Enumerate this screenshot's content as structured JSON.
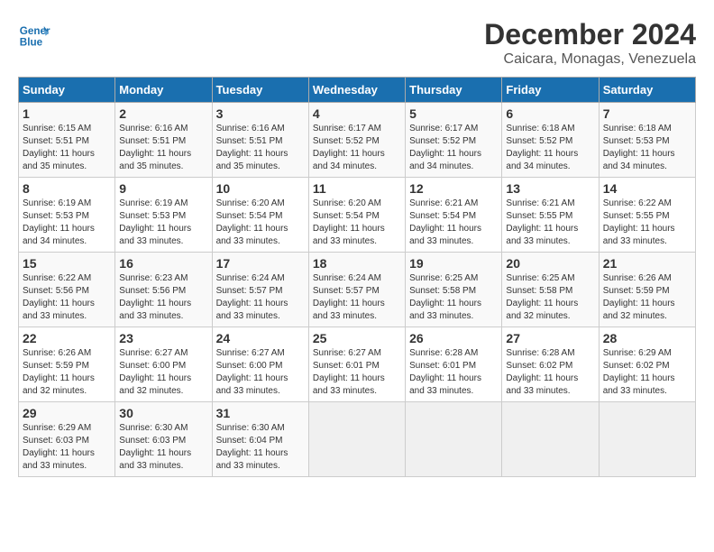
{
  "logo": {
    "line1": "General",
    "line2": "Blue"
  },
  "title": "December 2024",
  "location": "Caicara, Monagas, Venezuela",
  "weekdays": [
    "Sunday",
    "Monday",
    "Tuesday",
    "Wednesday",
    "Thursday",
    "Friday",
    "Saturday"
  ],
  "weeks": [
    [
      {
        "day": "1",
        "info": "Sunrise: 6:15 AM\nSunset: 5:51 PM\nDaylight: 11 hours\nand 35 minutes."
      },
      {
        "day": "2",
        "info": "Sunrise: 6:16 AM\nSunset: 5:51 PM\nDaylight: 11 hours\nand 35 minutes."
      },
      {
        "day": "3",
        "info": "Sunrise: 6:16 AM\nSunset: 5:51 PM\nDaylight: 11 hours\nand 35 minutes."
      },
      {
        "day": "4",
        "info": "Sunrise: 6:17 AM\nSunset: 5:52 PM\nDaylight: 11 hours\nand 34 minutes."
      },
      {
        "day": "5",
        "info": "Sunrise: 6:17 AM\nSunset: 5:52 PM\nDaylight: 11 hours\nand 34 minutes."
      },
      {
        "day": "6",
        "info": "Sunrise: 6:18 AM\nSunset: 5:52 PM\nDaylight: 11 hours\nand 34 minutes."
      },
      {
        "day": "7",
        "info": "Sunrise: 6:18 AM\nSunset: 5:53 PM\nDaylight: 11 hours\nand 34 minutes."
      }
    ],
    [
      {
        "day": "8",
        "info": "Sunrise: 6:19 AM\nSunset: 5:53 PM\nDaylight: 11 hours\nand 34 minutes."
      },
      {
        "day": "9",
        "info": "Sunrise: 6:19 AM\nSunset: 5:53 PM\nDaylight: 11 hours\nand 33 minutes."
      },
      {
        "day": "10",
        "info": "Sunrise: 6:20 AM\nSunset: 5:54 PM\nDaylight: 11 hours\nand 33 minutes."
      },
      {
        "day": "11",
        "info": "Sunrise: 6:20 AM\nSunset: 5:54 PM\nDaylight: 11 hours\nand 33 minutes."
      },
      {
        "day": "12",
        "info": "Sunrise: 6:21 AM\nSunset: 5:54 PM\nDaylight: 11 hours\nand 33 minutes."
      },
      {
        "day": "13",
        "info": "Sunrise: 6:21 AM\nSunset: 5:55 PM\nDaylight: 11 hours\nand 33 minutes."
      },
      {
        "day": "14",
        "info": "Sunrise: 6:22 AM\nSunset: 5:55 PM\nDaylight: 11 hours\nand 33 minutes."
      }
    ],
    [
      {
        "day": "15",
        "info": "Sunrise: 6:22 AM\nSunset: 5:56 PM\nDaylight: 11 hours\nand 33 minutes."
      },
      {
        "day": "16",
        "info": "Sunrise: 6:23 AM\nSunset: 5:56 PM\nDaylight: 11 hours\nand 33 minutes."
      },
      {
        "day": "17",
        "info": "Sunrise: 6:24 AM\nSunset: 5:57 PM\nDaylight: 11 hours\nand 33 minutes."
      },
      {
        "day": "18",
        "info": "Sunrise: 6:24 AM\nSunset: 5:57 PM\nDaylight: 11 hours\nand 33 minutes."
      },
      {
        "day": "19",
        "info": "Sunrise: 6:25 AM\nSunset: 5:58 PM\nDaylight: 11 hours\nand 33 minutes."
      },
      {
        "day": "20",
        "info": "Sunrise: 6:25 AM\nSunset: 5:58 PM\nDaylight: 11 hours\nand 32 minutes."
      },
      {
        "day": "21",
        "info": "Sunrise: 6:26 AM\nSunset: 5:59 PM\nDaylight: 11 hours\nand 32 minutes."
      }
    ],
    [
      {
        "day": "22",
        "info": "Sunrise: 6:26 AM\nSunset: 5:59 PM\nDaylight: 11 hours\nand 32 minutes."
      },
      {
        "day": "23",
        "info": "Sunrise: 6:27 AM\nSunset: 6:00 PM\nDaylight: 11 hours\nand 32 minutes."
      },
      {
        "day": "24",
        "info": "Sunrise: 6:27 AM\nSunset: 6:00 PM\nDaylight: 11 hours\nand 33 minutes."
      },
      {
        "day": "25",
        "info": "Sunrise: 6:27 AM\nSunset: 6:01 PM\nDaylight: 11 hours\nand 33 minutes."
      },
      {
        "day": "26",
        "info": "Sunrise: 6:28 AM\nSunset: 6:01 PM\nDaylight: 11 hours\nand 33 minutes."
      },
      {
        "day": "27",
        "info": "Sunrise: 6:28 AM\nSunset: 6:02 PM\nDaylight: 11 hours\nand 33 minutes."
      },
      {
        "day": "28",
        "info": "Sunrise: 6:29 AM\nSunset: 6:02 PM\nDaylight: 11 hours\nand 33 minutes."
      }
    ],
    [
      {
        "day": "29",
        "info": "Sunrise: 6:29 AM\nSunset: 6:03 PM\nDaylight: 11 hours\nand 33 minutes."
      },
      {
        "day": "30",
        "info": "Sunrise: 6:30 AM\nSunset: 6:03 PM\nDaylight: 11 hours\nand 33 minutes."
      },
      {
        "day": "31",
        "info": "Sunrise: 6:30 AM\nSunset: 6:04 PM\nDaylight: 11 hours\nand 33 minutes."
      },
      {
        "day": "",
        "info": ""
      },
      {
        "day": "",
        "info": ""
      },
      {
        "day": "",
        "info": ""
      },
      {
        "day": "",
        "info": ""
      }
    ]
  ]
}
